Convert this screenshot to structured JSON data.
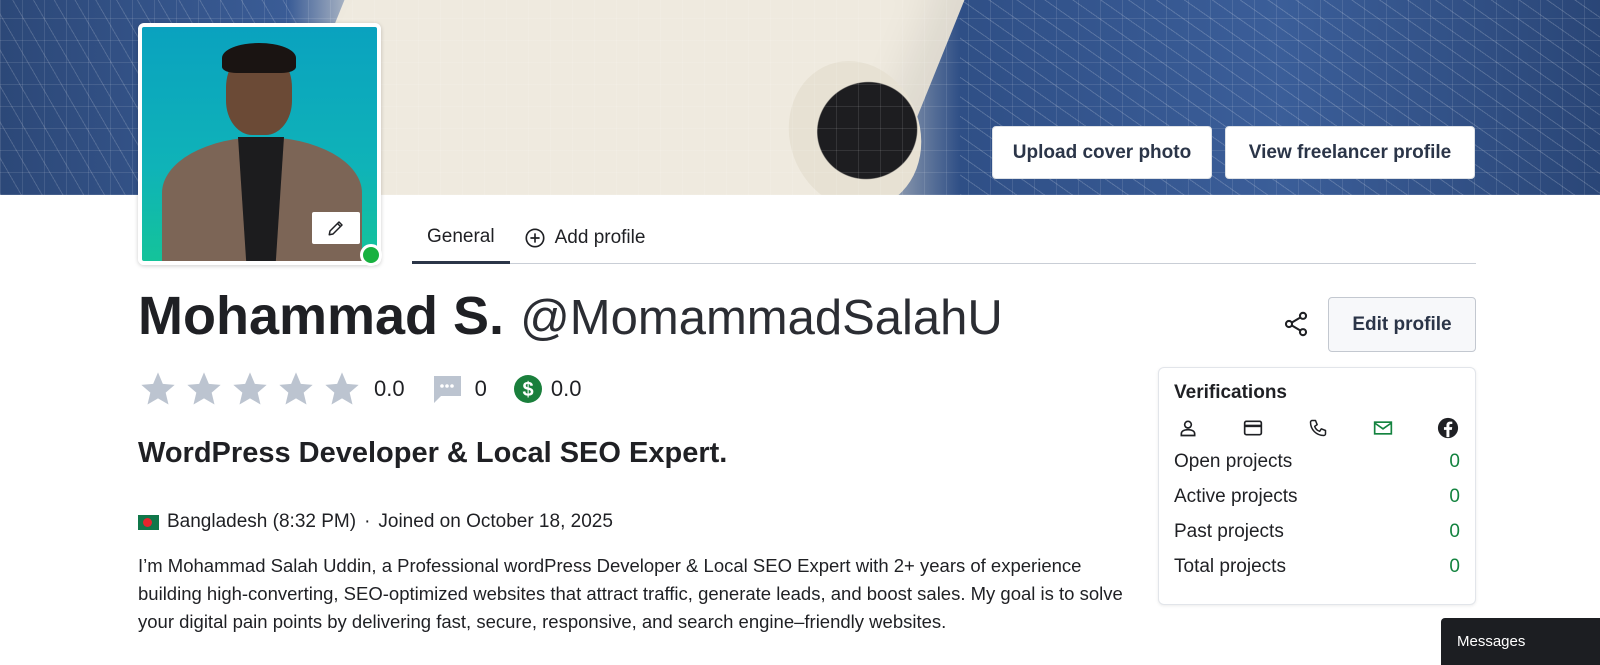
{
  "cover": {
    "upload_label": "Upload cover photo",
    "view_label": "View freelancer profile"
  },
  "tabs": [
    {
      "label": "General",
      "active": true
    },
    {
      "label": "Add profile",
      "icon": "plus-circle-icon"
    }
  ],
  "profile": {
    "name": "Mohammad S.",
    "username": "@MomammadSalahU",
    "online": true,
    "edit_label": "Edit profile",
    "rating": "0.0",
    "stars_total": 5,
    "stars_filled": 0,
    "reviews": "0",
    "earnings": "0.0",
    "headline": "WordPress Developer & Local SEO Expert.",
    "country": "Bangladesh (8:32 PM)",
    "separator": "·",
    "joined": "Joined on October 18, 2025",
    "bio": "I’m Mohammad Salah Uddin, a Professional wordPress Developer & Local SEO Expert with 2+ years of experience building high-converting, SEO-optimized websites that attract traffic, generate leads, and boost sales. My goal is to solve your digital pain points by delivering fast, secure, responsive, and search engine–friendly websites."
  },
  "verifications": {
    "title": "Verifications",
    "icons": [
      {
        "name": "identity-icon",
        "verified": false
      },
      {
        "name": "payment-card-icon",
        "verified": false
      },
      {
        "name": "phone-icon",
        "verified": false
      },
      {
        "name": "email-icon",
        "verified": true
      },
      {
        "name": "facebook-icon",
        "verified": false
      }
    ],
    "projects": [
      {
        "label": "Open projects",
        "count": "0"
      },
      {
        "label": "Active projects",
        "count": "0"
      },
      {
        "label": "Past projects",
        "count": "0"
      },
      {
        "label": "Total projects",
        "count": "0"
      }
    ]
  },
  "messages": {
    "label": "Messages"
  },
  "colors": {
    "verified_green": "#13833f",
    "online_green": "#17b13f",
    "dollar_green": "#1a7f3c",
    "star_gray": "#bcc4d0",
    "button_text": "#2b3548"
  }
}
